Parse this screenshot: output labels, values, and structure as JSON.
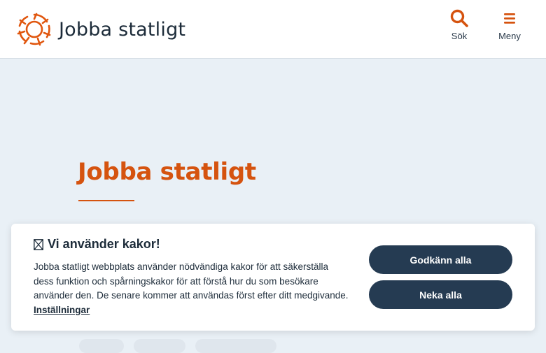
{
  "header": {
    "logo_text": "Jobba statligt",
    "search_label": "Sök",
    "menu_label": "Meny"
  },
  "hero": {
    "title": "Jobba statligt"
  },
  "cookie_banner": {
    "title": "Vi använder kakor!",
    "body": "Jobba statligt webbplats använder nödvändiga kakor för att säkerställa dess funktion och spårningskakor för att förstå hur du som besökare använder den. De senare kommer att användas först efter ditt medgivande.",
    "settings_link": "Inställningar",
    "accept_label": "Godkänn alla",
    "decline_label": "Neka alla"
  },
  "colors": {
    "brand_orange": "#d5530f",
    "button_navy": "#253b52",
    "page_bg": "#e9f0f6"
  }
}
